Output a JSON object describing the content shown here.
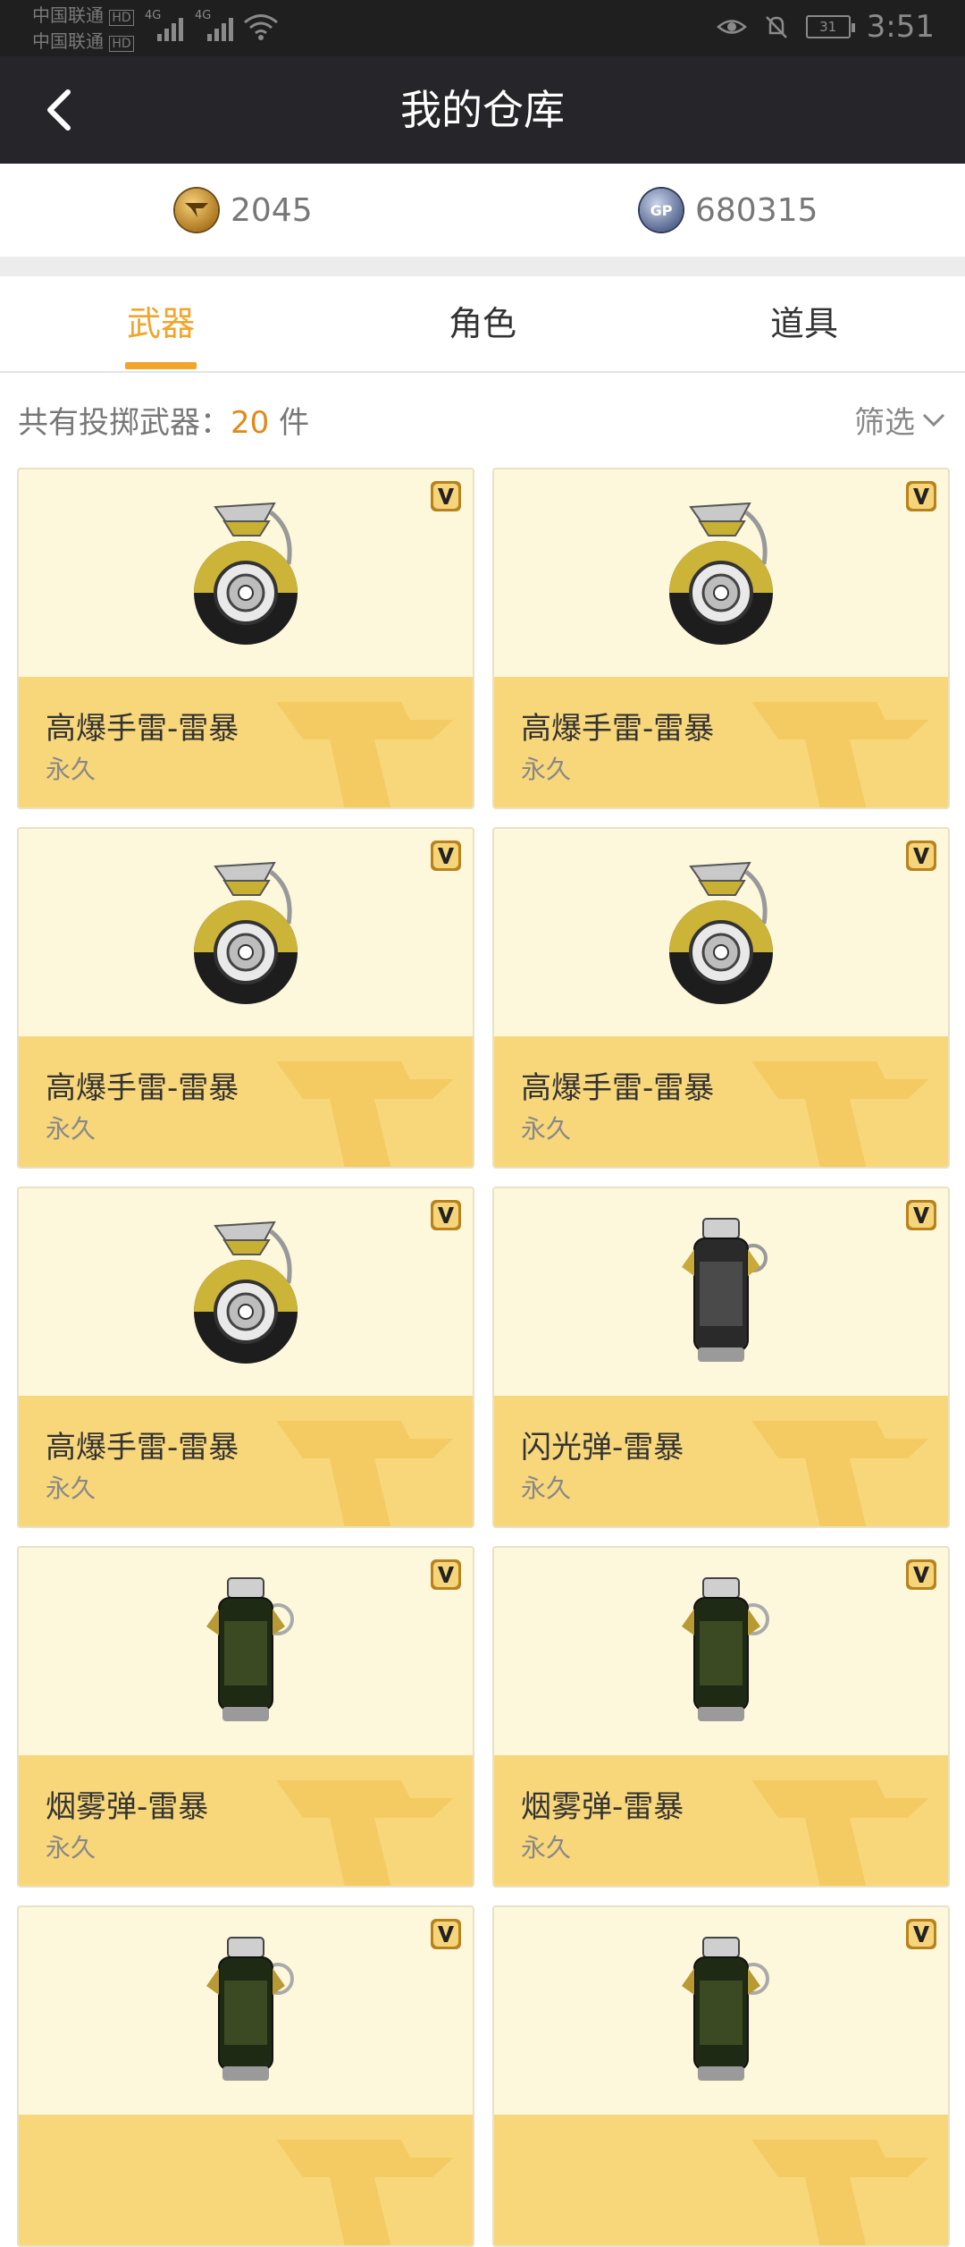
{
  "status_bar": {
    "carrier_1": "中国联通",
    "carrier_2": "中国联通",
    "hd_badge": "HD",
    "network_1": "4G",
    "network_2": "4G",
    "battery": "31",
    "time": "3:51"
  },
  "header": {
    "title": "我的仓库",
    "back_icon": "chevron-left-icon"
  },
  "currency": {
    "cf_points": "2045",
    "gp_points": "680315",
    "gp_label": "GP"
  },
  "tabs": [
    {
      "label": "武器",
      "active": true
    },
    {
      "label": "角色",
      "active": false
    },
    {
      "label": "道具",
      "active": false
    }
  ],
  "summary": {
    "prefix": "共有投掷武器：",
    "count": "20",
    "suffix": "件"
  },
  "filter": {
    "label": "筛选"
  },
  "items": [
    {
      "name": "高爆手雷-雷暴",
      "duration": "永久",
      "icon": "he-grenade"
    },
    {
      "name": "高爆手雷-雷暴",
      "duration": "永久",
      "icon": "he-grenade"
    },
    {
      "name": "高爆手雷-雷暴",
      "duration": "永久",
      "icon": "he-grenade"
    },
    {
      "name": "高爆手雷-雷暴",
      "duration": "永久",
      "icon": "he-grenade"
    },
    {
      "name": "高爆手雷-雷暴",
      "duration": "永久",
      "icon": "he-grenade"
    },
    {
      "name": "闪光弹-雷暴",
      "duration": "永久",
      "icon": "flash-grenade"
    },
    {
      "name": "烟雾弹-雷暴",
      "duration": "永久",
      "icon": "smoke-grenade"
    },
    {
      "name": "烟雾弹-雷暴",
      "duration": "永久",
      "icon": "smoke-grenade"
    },
    {
      "name": "",
      "duration": "",
      "icon": "smoke-grenade"
    },
    {
      "name": "",
      "duration": "",
      "icon": "smoke-grenade"
    }
  ],
  "colors": {
    "accent": "#f1a52b",
    "card_top": "#fdf7dc",
    "card_bottom": "#f8d77b",
    "title_bar": "#26262a"
  }
}
